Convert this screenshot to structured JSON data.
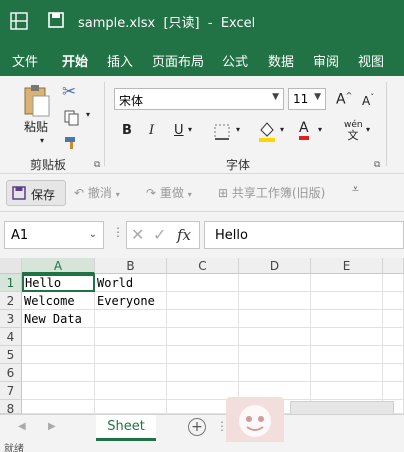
{
  "titlebar": {
    "filename": "sample.xlsx",
    "readonly": "[只读]",
    "separator": "-",
    "app": "Excel"
  },
  "tabs": [
    "文件",
    "开始",
    "插入",
    "页面布局",
    "公式",
    "数据",
    "审阅",
    "视图"
  ],
  "ribbon": {
    "paste_label": "粘贴",
    "clipboard_label": "剪贴板",
    "font_label": "字体",
    "font_name": "宋体",
    "font_size": "11",
    "bold": "B",
    "italic": "I",
    "underline": "U",
    "grow_font": "A",
    "shrink_font": "A",
    "phonetic_top": "wén",
    "phonetic_bottom": "文",
    "font_color_letter": "A"
  },
  "qat": {
    "save": "保存",
    "undo": "撤消",
    "redo": "重做",
    "share": "共享工作簿(旧版)"
  },
  "formula": {
    "namebox": "A1",
    "fx": "fx",
    "value": "Hello"
  },
  "grid": {
    "columns": [
      "A",
      "B",
      "C",
      "D",
      "E"
    ],
    "rows": [
      "1",
      "2",
      "3",
      "4",
      "5",
      "6",
      "7",
      "8"
    ],
    "cells": [
      [
        "Hello",
        "World"
      ],
      [
        "Welcome",
        "Everyone"
      ],
      [
        "New Data",
        ""
      ]
    ]
  },
  "sheets": {
    "tab": "Sheet",
    "add": "+"
  },
  "status": "就绪"
}
